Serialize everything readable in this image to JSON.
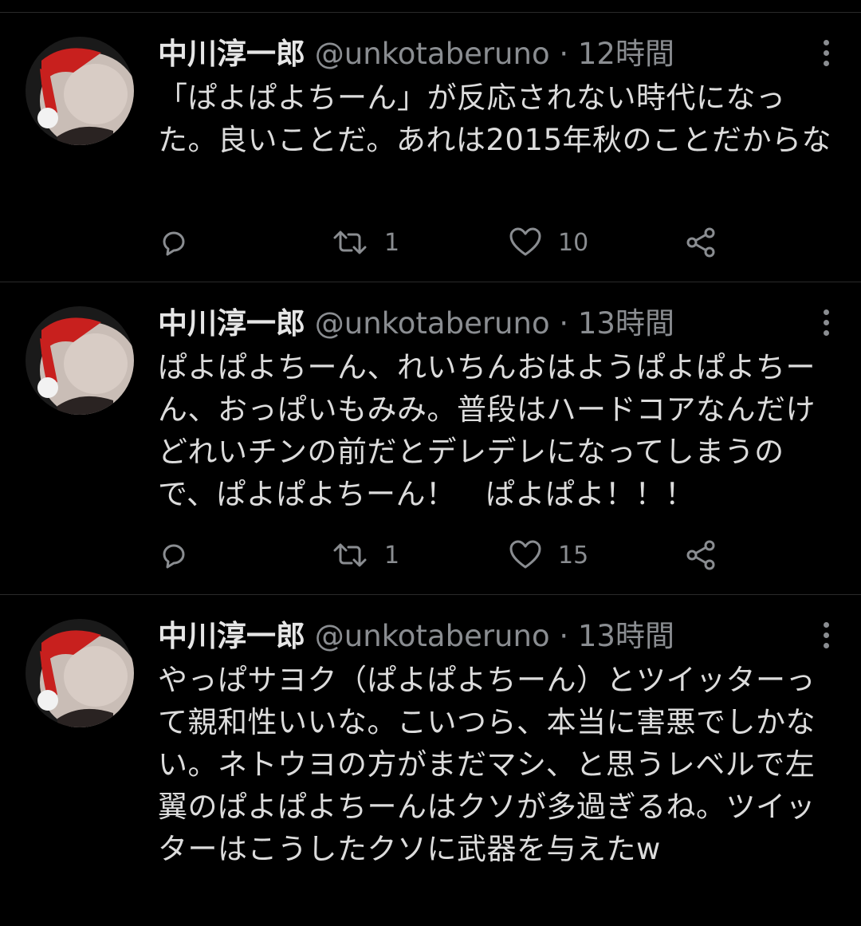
{
  "tweets": [
    {
      "name": "中川淳一郎",
      "handle": "@unkotaberuno",
      "separator": "·",
      "time": "12時間",
      "text": "「ぱよぱよちーん」が反応されない時代になった。良いことだ。あれは2015年秋のことだからな",
      "retweets": "1",
      "likes": "10"
    },
    {
      "name": "中川淳一郎",
      "handle": "@unkotaberuno",
      "separator": "·",
      "time": "13時間",
      "text": "ぱよぱよちーん、れいちんおはようぱよぱよちーん、おっぱいもみみ。普段はハードコアなんだけどれいチンの前だとデレデレになってしまうので、ぱよぱよちーん！　ぱよぱよ！！！",
      "retweets": "1",
      "likes": "15"
    },
    {
      "name": "中川淳一郎",
      "handle": "@unkotaberuno",
      "separator": "·",
      "time": "13時間",
      "text": "やっぱサヨク（ぱよぱよちーん）とツイッターって親和性いいな。こいつら、本当に害悪でしかない。ネトウヨの方がまだマシ、と思うレベルで左翼のぱよぱよちーんはクソが多過ぎるね。ツイッターはこうしたクソに武器を与えたw"
    }
  ],
  "icons": {
    "reply": "reply-icon",
    "retweet": "retweet-icon",
    "like": "heart-icon",
    "share": "share-icon",
    "more": "more-vertical-icon"
  },
  "colors": {
    "background": "#000000",
    "text": "#dcdcdc",
    "muted": "#8a8d91"
  }
}
